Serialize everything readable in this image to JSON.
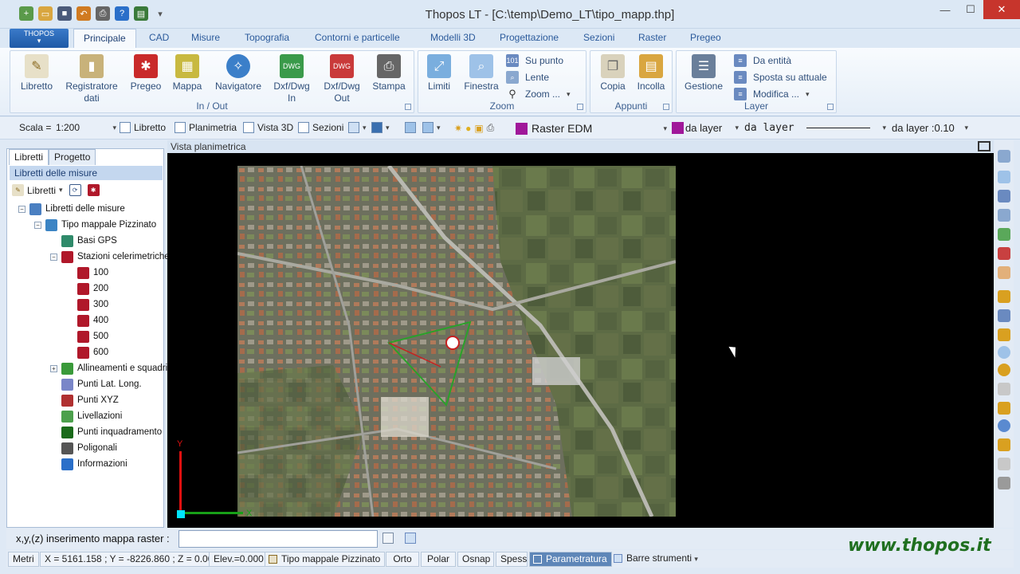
{
  "window": {
    "title": "Thopos LT - [C:\\temp\\Demo_LT\\tipo_mapp.thp]"
  },
  "app_button": {
    "label": "THOPOS"
  },
  "tabs": [
    "Principale",
    "CAD",
    "Misure",
    "Topografia",
    "Contorni e particelle",
    "Modelli 3D",
    "Progettazione",
    "Sezioni",
    "Raster",
    "Pregeo"
  ],
  "ribbon": {
    "inout": {
      "label": "In / Out",
      "buttons": [
        "Libretto",
        "Registratore dati",
        "Pregeo",
        "Mappa",
        "Navigatore",
        "Dxf/Dwg In",
        "Dxf/Dwg Out",
        "Stampa"
      ]
    },
    "zoom": {
      "label": "Zoom",
      "buttons": [
        "Limiti",
        "Finestra"
      ],
      "small": [
        "Su punto",
        "Lente",
        "Zoom ..."
      ]
    },
    "appunti": {
      "label": "Appunti",
      "buttons": [
        "Copia",
        "Incolla"
      ]
    },
    "layer": {
      "label": "Layer",
      "buttons": [
        "Gestione"
      ],
      "small": [
        "Da entità",
        "Sposta su attuale",
        "Modifica ..."
      ]
    }
  },
  "toolbar": {
    "scala_label": "Scala =",
    "scala_value": "1:200",
    "libretto": "Libretto",
    "planimetria": "Planimetria",
    "vista3d": "Vista 3D",
    "sezioni": "Sezioni",
    "layer_name": "Raster EDM",
    "color_label": "da layer",
    "linetype_label": "da layer",
    "lineweight_label": "da layer :0.10",
    "layer_color": "#a0189a"
  },
  "left_panel": {
    "tabs": [
      "Libretti",
      "Progetto"
    ],
    "header": "Libretti delle misure",
    "tool_label": "Libretti",
    "tree": [
      {
        "label": "Libretti delle misure",
        "level": 0,
        "expand": "−",
        "icon": "#4a7fc1"
      },
      {
        "label": "Tipo mappale Pizzinato",
        "level": 1,
        "expand": "−",
        "icon": "#3b84c4"
      },
      {
        "label": "Basi GPS",
        "level": 2,
        "expand": "",
        "icon": "#2f8a6a"
      },
      {
        "label": "Stazioni celerimetriche",
        "level": 2,
        "expand": "−",
        "icon": "#b0182a"
      },
      {
        "label": "100",
        "level": 3,
        "expand": "",
        "icon": "#b0182a"
      },
      {
        "label": "200",
        "level": 3,
        "expand": "",
        "icon": "#b0182a"
      },
      {
        "label": "300",
        "level": 3,
        "expand": "",
        "icon": "#b0182a"
      },
      {
        "label": "400",
        "level": 3,
        "expand": "",
        "icon": "#b0182a"
      },
      {
        "label": "500",
        "level": 3,
        "expand": "",
        "icon": "#b0182a"
      },
      {
        "label": "600",
        "level": 3,
        "expand": "",
        "icon": "#b0182a"
      },
      {
        "label": "Allineamenti e squadri",
        "level": 2,
        "expand": "+",
        "icon": "#3a9a3a"
      },
      {
        "label": "Punti Lat. Long.",
        "level": 2,
        "expand": "",
        "icon": "#7a86c8"
      },
      {
        "label": "Punti XYZ",
        "level": 2,
        "expand": "",
        "icon": "#b03030"
      },
      {
        "label": "Livellazioni",
        "level": 2,
        "expand": "",
        "icon": "#4ca04c"
      },
      {
        "label": "Punti inquadramento",
        "level": 2,
        "expand": "",
        "icon": "#1a6a1a"
      },
      {
        "label": "Poligonali",
        "level": 2,
        "expand": "",
        "icon": "#555555"
      },
      {
        "label": "Informazioni",
        "level": 2,
        "expand": "",
        "icon": "#2a6fc9"
      }
    ]
  },
  "map": {
    "title": "Vista planimetrica",
    "axis_x": "X",
    "axis_y": "Y"
  },
  "command": {
    "prompt": "x,y,(z) inserimento mappa raster :",
    "value": ""
  },
  "status": {
    "units": "Metri",
    "coords": "X = 5161.158 ; Y = -8226.860 ; Z = 0.000",
    "elev": "Elev.=0.000",
    "job": "Tipo mappale Pizzinato",
    "orto": "Orto",
    "polar": "Polar",
    "osnap": "Osnap",
    "spess": "Spess",
    "param": "Parametratura",
    "toolbars": "Barre strumenti"
  },
  "watermark": "www.thopos.it"
}
